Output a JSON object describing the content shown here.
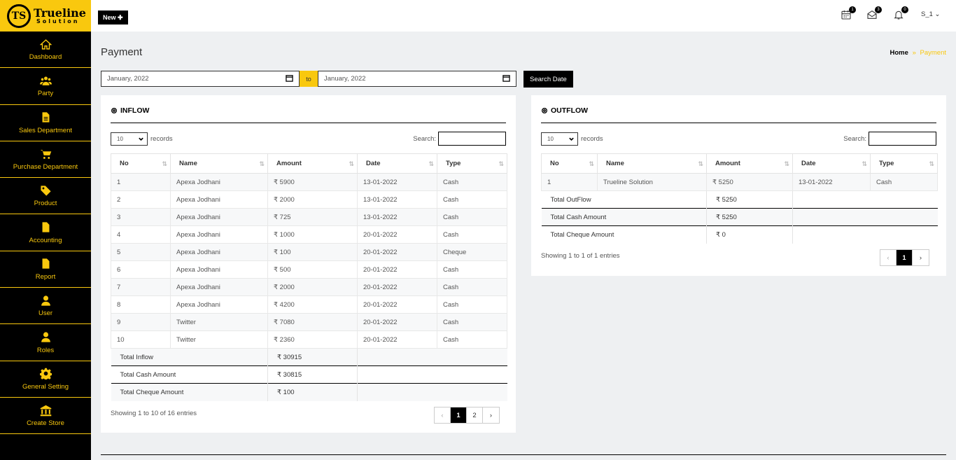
{
  "brand": {
    "mark": "TS",
    "name": "Trueline",
    "sub": "Solution"
  },
  "sidebar": {
    "items": [
      {
        "label": "Dashboard",
        "icon": "home-icon"
      },
      {
        "label": "Party",
        "icon": "users-icon"
      },
      {
        "label": "Sales Department",
        "icon": "file-icon"
      },
      {
        "label": "Purchase Department",
        "icon": "cart-icon"
      },
      {
        "label": "Product",
        "icon": "tag-icon"
      },
      {
        "label": "Accounting",
        "icon": "file-icon"
      },
      {
        "label": "Report",
        "icon": "file-icon"
      },
      {
        "label": "User",
        "icon": "user-icon"
      },
      {
        "label": "Roles",
        "icon": "user-icon"
      },
      {
        "label": "General Setting",
        "icon": "gear-icon"
      },
      {
        "label": "Create Store",
        "icon": "bank-icon"
      }
    ]
  },
  "header": {
    "new_label": "New ✚",
    "badges": {
      "calendar": "1",
      "mail": "3",
      "bell": "0"
    },
    "user": "S_1 ⌄"
  },
  "page": {
    "title": "Payment",
    "breadcrumb_home": "Home",
    "breadcrumb_sep": "»",
    "breadcrumb_current": "Payment"
  },
  "filter": {
    "from": "January, 2022",
    "to_label": "to",
    "to": "January, 2022",
    "search_button": "Search Date"
  },
  "inflow": {
    "title": "INFLOW",
    "length_value": "10",
    "records_label": "records",
    "search_label": "Search:",
    "columns": [
      "No",
      "Name",
      "Amount",
      "Date",
      "Type"
    ],
    "rows": [
      [
        "1",
        "Apexa Jodhani",
        "₹ 5900",
        "13-01-2022",
        "Cash"
      ],
      [
        "2",
        "Apexa Jodhani",
        "₹ 2000",
        "13-01-2022",
        "Cash"
      ],
      [
        "3",
        "Apexa Jodhani",
        "₹ 725",
        "13-01-2022",
        "Cash"
      ],
      [
        "4",
        "Apexa Jodhani",
        "₹ 1000",
        "20-01-2022",
        "Cash"
      ],
      [
        "5",
        "Apexa Jodhani",
        "₹ 100",
        "20-01-2022",
        "Cheque"
      ],
      [
        "6",
        "Apexa Jodhani",
        "₹ 500",
        "20-01-2022",
        "Cash"
      ],
      [
        "7",
        "Apexa Jodhani",
        "₹ 2000",
        "20-01-2022",
        "Cash"
      ],
      [
        "8",
        "Apexa Jodhani",
        "₹ 4200",
        "20-01-2022",
        "Cash"
      ],
      [
        "9",
        "Twitter",
        "₹ 7080",
        "20-01-2022",
        "Cash"
      ],
      [
        "10",
        "Twitter",
        "₹ 2360",
        "20-01-2022",
        "Cash"
      ]
    ],
    "totals": [
      {
        "label": "Total Inflow",
        "value": "₹ 30915"
      },
      {
        "label": "Total Cash Amount",
        "value": "₹ 30815"
      },
      {
        "label": "Total Cheque Amount",
        "value": "₹ 100"
      }
    ],
    "info": "Showing 1 to 10 of 16 entries",
    "pages": [
      "‹",
      "1",
      "2",
      "›"
    ],
    "current_page": "1"
  },
  "outflow": {
    "title": "OUTFLOW",
    "length_value": "10",
    "records_label": "records",
    "search_label": "Search:",
    "columns": [
      "No",
      "Name",
      "Amount",
      "Date",
      "Type"
    ],
    "rows": [
      [
        "1",
        "Trueline Solution",
        "₹ 5250",
        "13-01-2022",
        "Cash"
      ]
    ],
    "totals": [
      {
        "label": "Total OutFlow",
        "value": "₹ 5250"
      },
      {
        "label": "Total Cash Amount",
        "value": "₹ 5250"
      },
      {
        "label": "Total Cheque Amount",
        "value": "₹ 0"
      }
    ],
    "info": "Showing 1 to 1 of 1 entries",
    "pages": [
      "‹",
      "1",
      "›"
    ],
    "current_page": "1"
  },
  "colors": {
    "accent": "#f9c80e",
    "dark": "#000000"
  }
}
